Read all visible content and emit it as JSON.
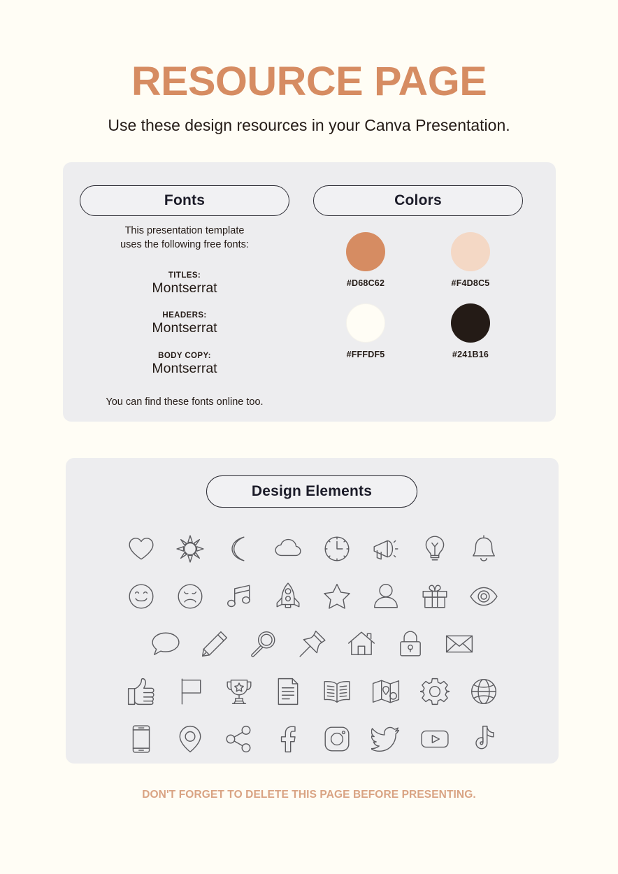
{
  "header": {
    "title": "RESOURCE PAGE",
    "subtitle": "Use these design resources in your Canva Presentation."
  },
  "fonts_panel": {
    "pill_label": "Fonts",
    "intro": "This presentation template\nuses the following free fonts:",
    "groups": [
      {
        "role": "TITLES:",
        "font": "Montserrat"
      },
      {
        "role": "HEADERS:",
        "font": "Montserrat"
      },
      {
        "role": "BODY COPY:",
        "font": "Montserrat"
      }
    ],
    "outro": "You can find these fonts online too."
  },
  "colors_panel": {
    "pill_label": "Colors",
    "swatches": [
      {
        "hex": "#D68C62",
        "label": "#D68C62"
      },
      {
        "hex": "#F4D8C5",
        "label": "#F4D8C5"
      },
      {
        "hex": "#FFFDF5",
        "label": "#FFFDF5"
      },
      {
        "hex": "#241B16",
        "label": "#241B16"
      }
    ]
  },
  "design_elements_panel": {
    "pill_label": "Design Elements",
    "rows": [
      [
        "heart-icon",
        "sun-icon",
        "moon-icon",
        "cloud-icon",
        "clock-icon",
        "megaphone-icon",
        "lightbulb-icon",
        "bell-icon"
      ],
      [
        "smiley-face-icon",
        "sad-face-icon",
        "music-note-icon",
        "rocket-icon",
        "star-icon",
        "person-icon",
        "gift-icon",
        "eye-icon"
      ],
      [
        "speech-bubble-icon",
        "pencil-icon",
        "magnifier-icon",
        "pushpin-icon",
        "house-icon",
        "lock-icon",
        "envelope-icon"
      ],
      [
        "thumbs-up-icon",
        "flag-icon",
        "trophy-icon",
        "document-icon",
        "book-icon",
        "map-icon",
        "gear-icon",
        "globe-icon"
      ],
      [
        "smartphone-icon",
        "location-pin-icon",
        "share-icon",
        "facebook-icon",
        "instagram-icon",
        "twitter-icon",
        "youtube-icon",
        "tiktok-icon"
      ]
    ]
  },
  "footer": {
    "note": "DON'T FORGET TO DELETE THIS PAGE BEFORE PRESENTING."
  },
  "theme": {
    "background": "#FFFDF5",
    "panel_background": "#EDEDEF",
    "accent": "#D68C62",
    "text": "#241B16",
    "footer_text": "#D9A383",
    "icon_stroke": "#5B5B5F"
  }
}
